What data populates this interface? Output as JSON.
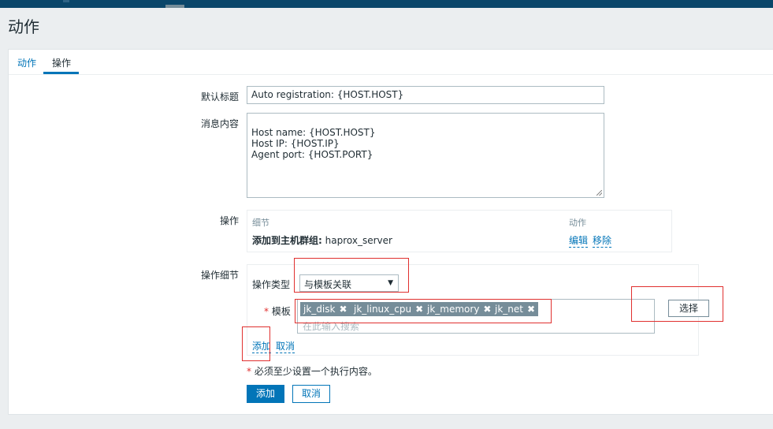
{
  "page": {
    "title": "动作"
  },
  "tabs": [
    {
      "label": "动作"
    },
    {
      "label": "操作"
    }
  ],
  "form": {
    "default_subject": {
      "label": "默认标题",
      "value": "Auto registration: {HOST.HOST}"
    },
    "default_message": {
      "label": "消息内容",
      "value": "Host name: {HOST.HOST}\nHost IP: {HOST.IP}\nAgent port: {HOST.PORT}"
    },
    "operations": {
      "label": "操作",
      "col_details": "细节",
      "col_action": "动作",
      "row_detail_bold": "添加到主机群组:",
      "row_detail_value": "haprox_server",
      "edit": "编辑",
      "remove": "移除"
    },
    "operation_details": {
      "label": "操作细节",
      "type_label": "操作类型",
      "type_value": "与模板关联",
      "template_label": "模板",
      "required_star": "*",
      "templates": [
        "jk_disk",
        "jk_linux_cpu",
        "jk_memory",
        "jk_net"
      ],
      "search_placeholder": "在此输入搜索",
      "select_button": "选择",
      "add_link": "添加",
      "cancel_link": "取消"
    },
    "note": {
      "star": "*",
      "text": "必须至少设置一个执行内容。"
    },
    "buttons": {
      "add": "添加",
      "cancel": "取消"
    }
  },
  "colors": {
    "accent": "#0275b8",
    "header": "#0a466a",
    "highlight": "#e0302f"
  }
}
